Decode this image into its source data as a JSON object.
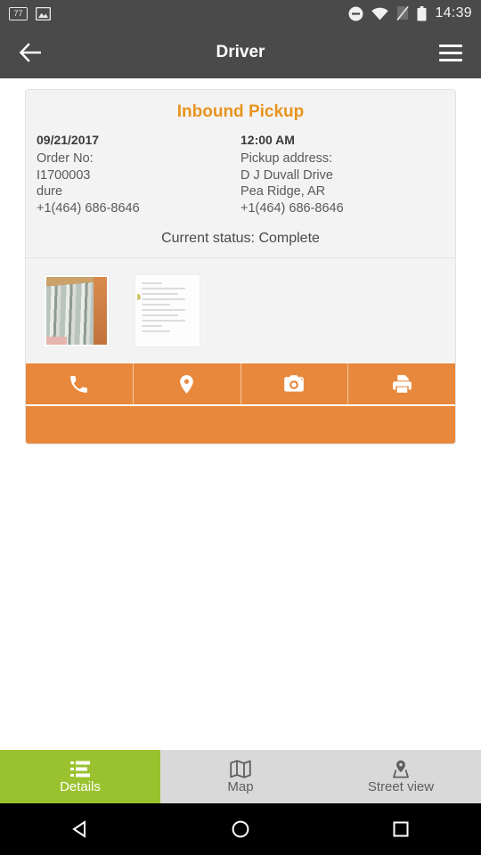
{
  "status_bar": {
    "notification_badge": "77",
    "icons_left": [
      "counter-77-icon",
      "image-icon"
    ],
    "icons_right": [
      "do-not-disturb-icon",
      "wifi-icon",
      "no-sim-icon",
      "battery-icon"
    ],
    "clock": "14:39"
  },
  "toolbar": {
    "title": "Driver",
    "back_icon": "back-arrow-icon",
    "menu_icon": "hamburger-menu-icon"
  },
  "card": {
    "title": "Inbound Pickup",
    "left_column": {
      "date": "09/21/2017",
      "order_label": "Order No:",
      "order_no": "I1700003",
      "contact": "dure",
      "phone": "+1(464) 686-8646"
    },
    "right_column": {
      "time": "12:00 AM",
      "address_label": "Pickup address:",
      "address_line1": "D J Duvall Drive",
      "address_line2": "Pea Ridge, AR",
      "phone": "+1(464) 686-8646"
    },
    "status_text": "Current status: Complete",
    "attachments": [
      {
        "name": "photo-thumbnail",
        "kind": "photo"
      },
      {
        "name": "document-thumbnail",
        "kind": "document"
      }
    ],
    "actions": [
      {
        "name": "call-button",
        "icon": "phone-icon"
      },
      {
        "name": "location-button",
        "icon": "map-pin-icon"
      },
      {
        "name": "camera-button",
        "icon": "camera-icon"
      },
      {
        "name": "print-button",
        "icon": "printer-icon"
      }
    ]
  },
  "bottom_nav": {
    "items": [
      {
        "label": "Details",
        "icon": "list-icon",
        "active": true
      },
      {
        "label": "Map",
        "icon": "map-icon",
        "active": false
      },
      {
        "label": "Street view",
        "icon": "street-view-icon",
        "active": false
      }
    ]
  },
  "system_nav": {
    "back": "triangle-back-icon",
    "home": "circle-home-icon",
    "recents": "square-recents-icon"
  },
  "colors": {
    "accent_orange": "#e8883c",
    "title_orange": "#e8941f",
    "active_green": "#9ac22e",
    "toolbar_grey": "#4a4a4a",
    "card_grey": "#f3f3f3",
    "nav_grey": "#d9d9d9"
  }
}
